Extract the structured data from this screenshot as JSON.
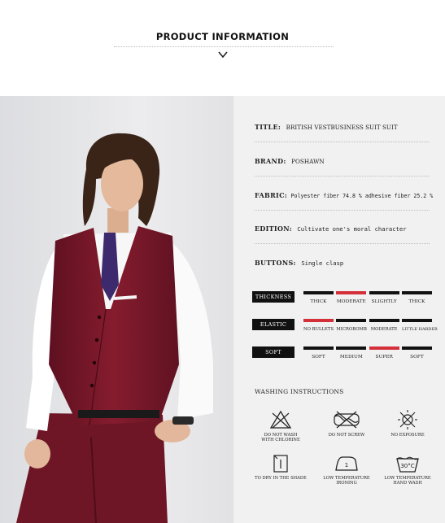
{
  "header": {
    "title": "PRODUCT INFORMATION"
  },
  "specs": [
    {
      "label": "TITLE:",
      "value": "BRITISH VESTBUSINESS SUIT SUIT"
    },
    {
      "label": "BRAND:",
      "value": "POSHAWN"
    },
    {
      "label": "FABRIC:",
      "value": "Polyester fiber 74.8 % adhesive fiber 25.2 %"
    },
    {
      "label": "EDITION:",
      "value": "Cultivate one's moral character"
    },
    {
      "label": "BUTTONS:",
      "value": "Single clasp"
    }
  ],
  "scales": [
    {
      "tag": "THICKNESS",
      "options": [
        "THICK",
        "MODERATE",
        "SLIGHTLY",
        "THICK"
      ],
      "selected_index": 1
    },
    {
      "tag": "ELASTIC",
      "options": [
        "NO BULLETS",
        "MICROBOMB",
        "MODERATE",
        "LITTLE HARDER"
      ],
      "selected_index": 0
    },
    {
      "tag": "SOFT",
      "options": [
        "SOFT",
        "MEDIUM",
        "SUPER",
        "SOFT"
      ],
      "selected_index": 2
    }
  ],
  "washing": {
    "title": "WASHING INSTRUCTIONS",
    "items": [
      {
        "icon": "no-chlorine-icon",
        "caption": [
          "DO NOT WASH",
          "WITH CHLORINE"
        ]
      },
      {
        "icon": "no-wring-icon",
        "caption": [
          "DO NOT SCREW"
        ]
      },
      {
        "icon": "no-exposure-icon",
        "caption": [
          "NO EXPOSURE"
        ]
      },
      {
        "icon": "dry-in-shade-icon",
        "caption": [
          "TO DRY IN THE SHADE"
        ]
      },
      {
        "icon": "low-temp-iron-icon",
        "caption": [
          "LOW TEMPERATURE",
          "IRONING"
        ]
      },
      {
        "icon": "hand-wash-30-icon",
        "caption": [
          "LOW TEMPERATURE",
          "HAND WASH"
        ]
      }
    ],
    "iron_mark": "1",
    "wash_temp": "30°C"
  },
  "colors": {
    "accent": "#d4303a",
    "vest": "#7d1a2b",
    "panel": "#f1f1f1",
    "photo_bg": "#e8e8ea"
  }
}
